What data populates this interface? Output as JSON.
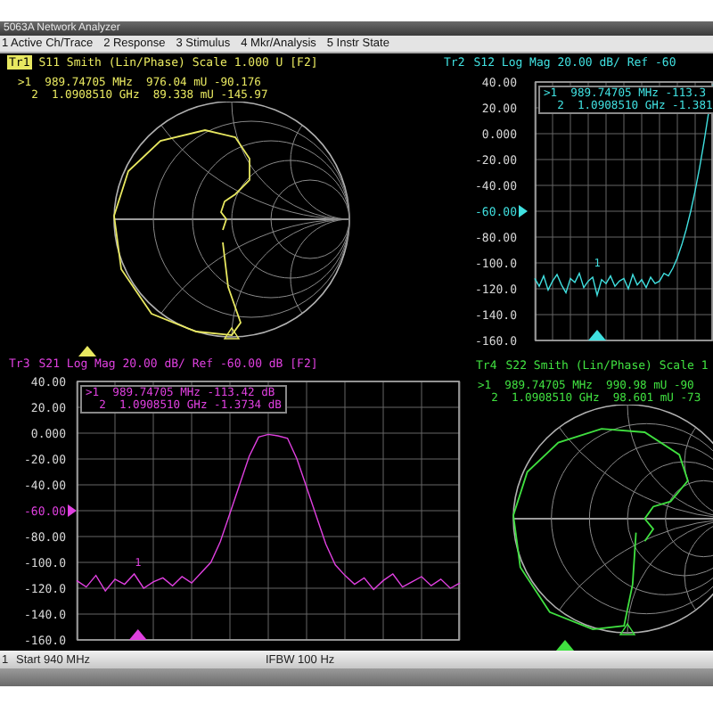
{
  "window": {
    "title": "5063A Network Analyzer"
  },
  "menu": [
    "1 Active Ch/Trace",
    "2 Response",
    "3 Stimulus",
    "4 Mkr/Analysis",
    "5 Instr State"
  ],
  "panels": [
    {
      "kind": "smith",
      "trace": "Tr1",
      "selected": true,
      "header": "S11 Smith (Lin/Phase) Scale 1.000 U [F2]",
      "color": "#e8e860",
      "markers": [
        ">1  989.74705 MHz  976.04 mU -90.176",
        "  2  1.0908510 GHz  89.338 mU -145.97"
      ]
    },
    {
      "kind": "logmag",
      "trace": "Tr2",
      "selected": false,
      "header": "S12 Log Mag 20.00 dB/ Ref -60",
      "color": "#40e0e0",
      "markers": [
        ">1  989.74705 MHz -113.3",
        "  2  1.0908510 GHz -1.381"
      ],
      "trace_labels": [
        "1"
      ],
      "tick_reference": [
        false,
        false,
        false,
        false,
        false,
        true,
        false,
        false,
        false,
        false,
        false
      ],
      "chart_data": {
        "type": "line",
        "categories": [
          null,
          null,
          null,
          null,
          null,
          null,
          null,
          null,
          null,
          null,
          null,
          null,
          null,
          null,
          null,
          null,
          null,
          null,
          null,
          null,
          null,
          null,
          null,
          null,
          null,
          null,
          null,
          null,
          null,
          null,
          null,
          null,
          null,
          null,
          null,
          null,
          null,
          null,
          null,
          null,
          null
        ],
        "grid": true,
        "ylim": [
          -160,
          40
        ],
        "yticks": [
          {
            "value": 40,
            "label": "40.00"
          },
          {
            "value": 20,
            "label": "20.00"
          },
          {
            "value": 0,
            "label": "0.000"
          },
          {
            "value": -20,
            "label": "-20.00"
          },
          {
            "value": -40,
            "label": "-40.00"
          },
          {
            "value": -60,
            "label": "-60.00"
          },
          {
            "value": -80,
            "label": "-80.00"
          },
          {
            "value": -100,
            "label": "-100.0"
          },
          {
            "value": -120,
            "label": "-120.0"
          },
          {
            "value": -140,
            "label": "-140.0"
          },
          {
            "value": -160,
            "label": "-160.0"
          }
        ],
        "series": [
          {
            "color": "#40e0e0",
            "values": [
              -112,
              -118,
              -110,
              -121,
              -114,
              -109,
              -117,
              -123,
              -112,
              -115,
              -108,
              -119,
              -114,
              -111,
              -125,
              -113,
              -116,
              -110,
              -118,
              -114,
              -112,
              -120,
              -109,
              -117,
              -113,
              -119,
              -111,
              -116,
              -114,
              -108,
              -110,
              -104,
              -96,
              -86,
              -74,
              -60,
              -44,
              -26,
              -6,
              16,
              38
            ]
          }
        ]
      }
    },
    {
      "kind": "logmag",
      "trace": "Tr3",
      "selected": false,
      "header": "S21 Log Mag 20.00 dB/ Ref -60.00 dB [F2]",
      "color": "#e040e0",
      "markers": [
        ">1  989.74705 MHz -113.42 dB",
        "  2  1.0908510 GHz -1.3734 dB"
      ],
      "trace_labels": [
        "1"
      ],
      "tick_reference": [
        false,
        false,
        false,
        false,
        false,
        true,
        false,
        false,
        false,
        false,
        false
      ],
      "chart_data": {
        "type": "line",
        "categories": [
          null,
          null,
          null,
          null,
          null,
          null,
          null,
          null,
          null,
          null,
          null,
          null,
          null,
          null,
          null,
          null,
          null,
          null,
          null,
          null,
          null,
          null,
          null,
          null,
          null,
          null,
          null,
          null,
          null,
          null,
          null,
          null,
          null,
          null,
          null,
          null,
          null,
          null,
          null,
          null,
          null
        ],
        "grid": true,
        "ylim": [
          -160,
          40
        ],
        "yticks": [
          {
            "value": 40,
            "label": "40.00"
          },
          {
            "value": 20,
            "label": "20.00"
          },
          {
            "value": 0,
            "label": "0.000"
          },
          {
            "value": -20,
            "label": "-20.00"
          },
          {
            "value": -40,
            "label": "-40.00"
          },
          {
            "value": -60,
            "label": "-60.00"
          },
          {
            "value": -80,
            "label": "-80.00"
          },
          {
            "value": -100,
            "label": "-100.0"
          },
          {
            "value": -120,
            "label": "-120.0"
          },
          {
            "value": -140,
            "label": "-140.0"
          },
          {
            "value": -160,
            "label": "-160.0"
          }
        ],
        "series": [
          {
            "color": "#e040e0",
            "values": [
              -114,
              -119,
              -110,
              -122,
              -113,
              -117,
              -109,
              -120,
              -115,
              -112,
              -118,
              -111,
              -116,
              -108,
              -100,
              -84,
              -62,
              -40,
              -18,
              -3,
              -1,
              -2,
              -4,
              -20,
              -42,
              -64,
              -86,
              -102,
              -110,
              -117,
              -112,
              -121,
              -114,
              -109,
              -119,
              -115,
              -111,
              -118,
              -113,
              -120,
              -116
            ]
          }
        ]
      }
    },
    {
      "kind": "smith",
      "trace": "Tr4",
      "selected": false,
      "header": "S22 Smith (Lin/Phase) Scale 1",
      "color": "#40e040",
      "markers": [
        ">1  989.74705 MHz  990.98 mU -90",
        "  2  1.0908510 GHz  98.601 mU -73"
      ]
    }
  ],
  "status_bar": {
    "channel": "1",
    "start": "Start 940 MHz",
    "ifbw": "IFBW 100 Hz"
  }
}
